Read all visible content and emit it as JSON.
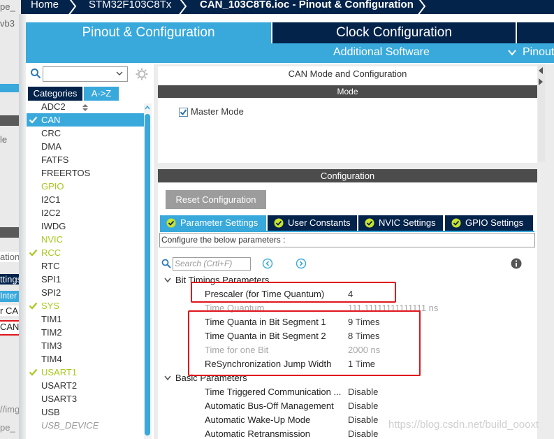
{
  "breadcrumb": [
    "Home",
    "STM32F103C8Tx",
    "CAN_103C8T6.ioc - Pinout & Configuration"
  ],
  "tabs": {
    "pinout": "Pinout & Configuration",
    "clock": "Clock Configuration",
    "additional": "Additional Software",
    "pinout_menu": "Pinout"
  },
  "left": {
    "tab_categories": "Categories",
    "tab_az": "A->Z",
    "items": [
      {
        "label": "ADC2",
        "state": "normal"
      },
      {
        "label": "CAN",
        "state": "selected",
        "checked": true
      },
      {
        "label": "CRC",
        "state": "normal"
      },
      {
        "label": "DMA",
        "state": "normal"
      },
      {
        "label": "FATFS",
        "state": "normal"
      },
      {
        "label": "FREERTOS",
        "state": "normal"
      },
      {
        "label": "GPIO",
        "state": "lime"
      },
      {
        "label": "I2C1",
        "state": "normal"
      },
      {
        "label": "I2C2",
        "state": "normal"
      },
      {
        "label": "IWDG",
        "state": "normal"
      },
      {
        "label": "NVIC",
        "state": "lime"
      },
      {
        "label": "RCC",
        "state": "lime",
        "checked": true
      },
      {
        "label": "RTC",
        "state": "normal"
      },
      {
        "label": "SPI1",
        "state": "normal"
      },
      {
        "label": "SPI2",
        "state": "normal"
      },
      {
        "label": "SYS",
        "state": "lime",
        "checked": true
      },
      {
        "label": "TIM1",
        "state": "normal"
      },
      {
        "label": "TIM2",
        "state": "normal"
      },
      {
        "label": "TIM3",
        "state": "normal"
      },
      {
        "label": "TIM4",
        "state": "normal"
      },
      {
        "label": "USART1",
        "state": "lime",
        "checked": true
      },
      {
        "label": "USART2",
        "state": "normal"
      },
      {
        "label": "USART3",
        "state": "normal"
      },
      {
        "label": "USB",
        "state": "normal"
      },
      {
        "label": "USB_DEVICE",
        "state": "italic"
      }
    ]
  },
  "mode": {
    "caption": "CAN Mode and Configuration",
    "header": "Mode",
    "master_mode": "Master Mode"
  },
  "config": {
    "header": "Configuration",
    "reset_button": "Reset Configuration",
    "tabs": [
      "Parameter Settings",
      "User Constants",
      "NVIC Settings",
      "GPIO Settings"
    ],
    "configure_label": "Configure the below parameters :",
    "search_placeholder": "Search (Crtl+F)",
    "bit_timings_group": "Bit Timings Parameters",
    "basic_group": "Basic Parameters",
    "params": [
      {
        "label": "Prescaler (for Time Quantum)",
        "value": "4",
        "dim": false
      },
      {
        "label": "Time Quantum",
        "value": "111.11111111111111 ns",
        "dim": true
      },
      {
        "label": "Time Quanta in Bit Segment 1",
        "value": "9 Times",
        "dim": false
      },
      {
        "label": "Time Quanta in Bit Segment 2",
        "value": "8 Times",
        "dim": false
      },
      {
        "label": "Time for one Bit",
        "value": "2000 ns",
        "dim": true
      },
      {
        "label": "ReSynchronization Jump Width",
        "value": "1 Time",
        "dim": false
      }
    ],
    "basic_params": [
      {
        "label": "Time Triggered Communication ...",
        "value": "Disable"
      },
      {
        "label": "Automatic Bus-Off Management",
        "value": "Disable"
      },
      {
        "label": "Automatic Wake-Up Mode",
        "value": "Disable"
      },
      {
        "label": "Automatic Retransmission",
        "value": "Disable"
      }
    ]
  },
  "background_window": [
    "pe_",
    "vb3",
    "le",
    "ation",
    "ttings",
    "Inter",
    "r CAN",
    "CAN",
    "//img",
    "pe_"
  ],
  "watermark": "https://blog.csdn.net/build_oooxt",
  "colors": {
    "accent": "#39a9dc",
    "navy": "#03234b",
    "lime": "#a8c81e",
    "highlight": "#e0161c"
  }
}
